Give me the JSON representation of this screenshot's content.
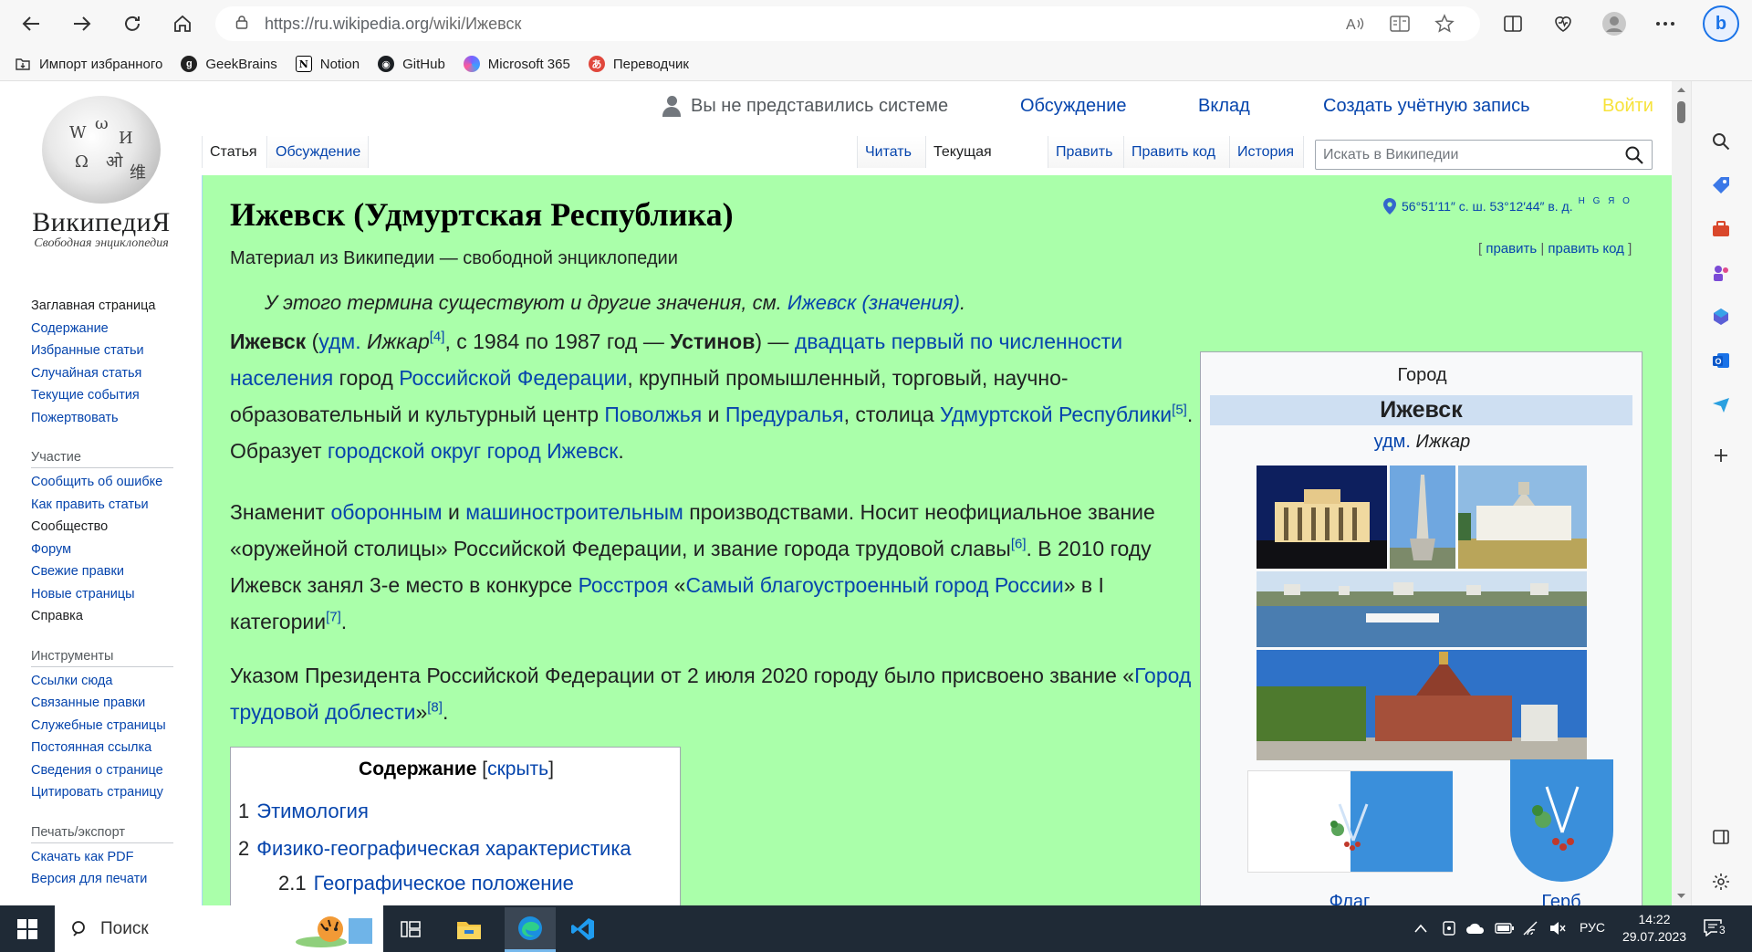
{
  "browser": {
    "url_host": "https://ru.wikipedia.org",
    "url_path": "/wiki/Ижевск",
    "bookmarks": [
      {
        "label": "Импорт избранного",
        "icon": "import-folder-icon"
      },
      {
        "label": "GeekBrains",
        "icon": "geekbrains-icon"
      },
      {
        "label": "Notion",
        "icon": "notion-icon"
      },
      {
        "label": "GitHub",
        "icon": "github-icon"
      },
      {
        "label": "Microsoft 365",
        "icon": "microsoft-365-icon"
      },
      {
        "label": "Переводчик",
        "icon": "translator-icon"
      }
    ]
  },
  "wiki": {
    "wordmark": "ВикипедиЯ",
    "tagline": "Свободная энциклопедия",
    "nav_main": [
      "Заглавная страница",
      "Содержание",
      "Избранные статьи",
      "Случайная статья",
      "Текущие события",
      "Пожертвовать"
    ],
    "nav_participation_heading": "Участие",
    "nav_participation": [
      "Сообщить об ошибке",
      "Как править статьи",
      "Сообщество",
      "Форум",
      "Свежие правки",
      "Новые страницы",
      "Справка"
    ],
    "nav_tools_heading": "Инструменты",
    "nav_tools": [
      "Ссылки сюда",
      "Связанные правки",
      "Служебные страницы",
      "Постоянная ссылка",
      "Сведения о странице",
      "Цитировать страницу"
    ],
    "nav_print_heading": "Печать/экспорт",
    "nav_print": [
      "Скачать как PDF",
      "Версия для печати"
    ],
    "personal": {
      "not_logged": "Вы не представились системе",
      "talk": "Обсуждение",
      "contributions": "Вклад",
      "create_account": "Создать учётную запись",
      "login": "Войти"
    },
    "tabs_left": [
      "Статья",
      "Обсуждение"
    ],
    "tabs_right": [
      "Читать",
      "Текущая версия",
      "Править",
      "Править код",
      "История"
    ],
    "search_placeholder": "Искать в Википедии"
  },
  "article": {
    "title": "Ижевск (Удмуртская Республика)",
    "coords": "56°51′11″ с. ш. 53°12′44″ в. д.",
    "coords_links": "H G Я O",
    "site_sub": "Материал из Википедии — свободной энциклопедии",
    "edit": "править",
    "edit_code": "править код",
    "hatnote_text": "У этого термина существуют и другие значения, см. ",
    "hatnote_link": "Ижевск (значения)",
    "p1": {
      "name": "Ижевск",
      "udm_link": "удм.",
      "udm_name": "Ижкар",
      "ref4": "[4]",
      "t1": ", с 1984 по 1987 год — ",
      "old_name": "Устинов",
      "t2": ") — ",
      "link_rank": "двадцать первый по численности населения",
      "t3": " город ",
      "link_rf": "Российской Федерации",
      "t4": ", крупный промышленный, торговый, научно-образовательный и культурный центр ",
      "link_volga": "Поволжья",
      "t5": " и ",
      "link_ural": "Предуралья",
      "t6": ", столица ",
      "link_udm": "Удмуртской Республики",
      "ref5": "[5]",
      "t7": ". Образует ",
      "link_okrug": "городской округ город Ижевск",
      "t8": "."
    },
    "p2": {
      "t1": "Знаменит ",
      "link_def": "оборонным",
      "t2": " и ",
      "link_mach": "машиностроительным",
      "t3": " производствами. Носит неофициальное звание «оружейной столицы» Российской Федерации, и звание города трудовой славы",
      "ref6": "[6]",
      "t4": ". В 2010 году Ижевск занял 3-е место в конкурсе ",
      "link_rosstroy": "Росстроя",
      "t5": " «",
      "link_contest": "Самый благоустроенный город России",
      "t6": "» в I категории",
      "ref7": "[7]",
      "t7": "."
    },
    "p3": {
      "t1": "Указом Президента Российской Федерации от 2 июля 2020 городу было присвоено звание «",
      "link_title": "Город трудовой доблести",
      "t2": "»",
      "ref8": "[8]",
      "t3": "."
    },
    "toc": {
      "title": "Содержание",
      "hide": "скрыть",
      "items": [
        {
          "num": "1",
          "text": "Этимология"
        },
        {
          "num": "2",
          "text": "Физико-географическая характеристика"
        },
        {
          "num": "2.1",
          "text": "Географическое положение"
        }
      ]
    },
    "infobox": {
      "type": "Город",
      "name": "Ижевск",
      "native_lang": "удм.",
      "native_name": "Ижкар",
      "flag_caption": "Флаг",
      "coat_caption": "Герб"
    }
  },
  "taskbar": {
    "search_label": "Поиск",
    "lang": "РУС",
    "time": "14:22",
    "date": "29.07.2023",
    "notifications": "3"
  }
}
